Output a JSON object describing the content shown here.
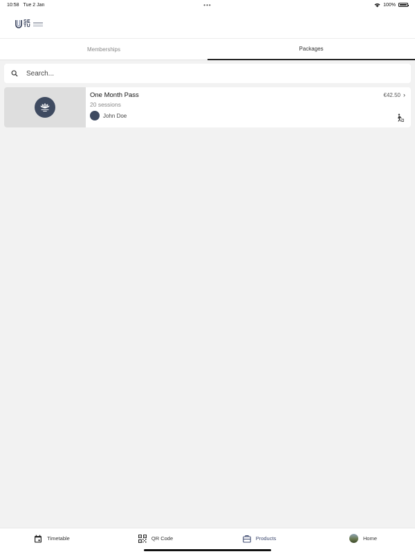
{
  "status": {
    "time": "10:58",
    "date": "Tue 2 Jan",
    "dots": "•••",
    "battery": "100%",
    "battery_level": 1.0
  },
  "logo": {
    "text_line1": "SE",
    "text_line2": "TU"
  },
  "tabs": [
    {
      "label": "Memberships",
      "active": false
    },
    {
      "label": "Packages",
      "active": true
    }
  ],
  "search": {
    "placeholder": "Search..."
  },
  "packages": [
    {
      "title": "One Month Pass",
      "subtitle": "20 sessions",
      "owner": "John Doe",
      "price": "€42.50"
    }
  ],
  "bottom_nav": {
    "timetable": "Timetable",
    "qr": "QR Code",
    "products": "Products",
    "home": "Home"
  },
  "colors": {
    "accent": "#3e4a60",
    "background": "#f2f2f2"
  }
}
